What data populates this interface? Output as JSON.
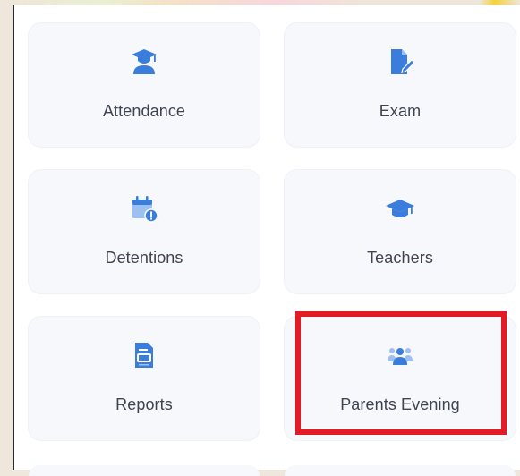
{
  "colors": {
    "icon": "#3b7ddd",
    "tile_bg": "#f6f8fc",
    "label": "#3e4450",
    "highlight": "#e31b25"
  },
  "tiles": [
    {
      "label": "Attendance",
      "icon": "graduate-icon"
    },
    {
      "label": "Exam",
      "icon": "document-edit-icon"
    },
    {
      "label": "Detentions",
      "icon": "calendar-alert-icon"
    },
    {
      "label": "Teachers",
      "icon": "graduation-cap-icon"
    },
    {
      "label": "Reports",
      "icon": "report-file-icon"
    },
    {
      "label": "Parents Evening",
      "icon": "group-icon"
    }
  ],
  "highlighted_tile": "Parents Evening"
}
